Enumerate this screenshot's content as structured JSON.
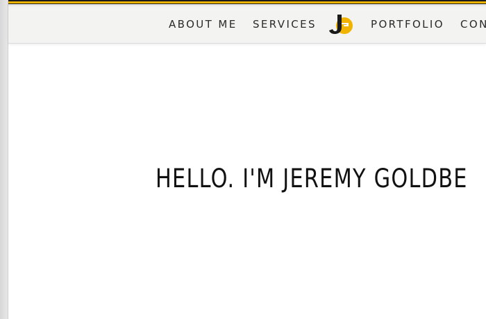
{
  "nav": {
    "items": [
      {
        "label": "ABOUT ME"
      },
      {
        "label": "SERVICES"
      },
      {
        "label": "PORTFOLIO"
      },
      {
        "label": "CONT"
      }
    ],
    "logo_text": "JG"
  },
  "hero": {
    "heading": "HELLO. I'M JEREMY GOLDBE"
  },
  "colors": {
    "accent": "#f0b400",
    "dark": "#1a1a1a",
    "header_bg": "#f3f3f1"
  }
}
